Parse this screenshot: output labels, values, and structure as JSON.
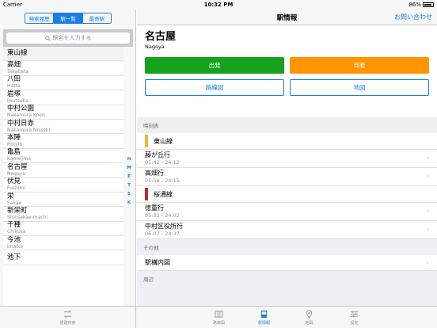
{
  "status": {
    "carrier": "Carrier",
    "time": "10:32 PM",
    "battery": "86%"
  },
  "left": {
    "segments": [
      "検索履歴",
      "駅一覧",
      "最寄駅"
    ],
    "search_placeholder": "駅名を入力する",
    "list_header": "東山線",
    "stations": [
      {
        "ja": "高畑",
        "en": "Takabata"
      },
      {
        "ja": "八田",
        "en": "Hatta"
      },
      {
        "ja": "岩塚",
        "en": "Iwatsuka"
      },
      {
        "ja": "中村公園",
        "en": "Nakamura Koen"
      },
      {
        "ja": "中村日赤",
        "en": "Nakamura Nisseki"
      },
      {
        "ja": "本陣",
        "en": "Honjin"
      },
      {
        "ja": "亀島",
        "en": "Kamejima"
      },
      {
        "ja": "名古屋",
        "en": "Nagoya"
      },
      {
        "ja": "伏見",
        "en": "Fushimi"
      },
      {
        "ja": "栄",
        "en": "Sakae"
      },
      {
        "ja": "新栄町",
        "en": "Shinsakae-machi"
      },
      {
        "ja": "千種",
        "en": "Chikusa"
      },
      {
        "ja": "今池",
        "en": "Imaike"
      },
      {
        "ja": "池下",
        "en": ""
      }
    ],
    "index": [
      "H",
      "M",
      "E",
      "T",
      "S",
      "K"
    ]
  },
  "right": {
    "nav_title": "駅情報",
    "contact_label": "お問い合わせ",
    "station_name": "名古屋",
    "station_romaji": "Nagoya",
    "depart_label": "出発",
    "arrive_label": "到着",
    "route_map_label": "路線図",
    "map_label": "地図",
    "timetable_header": "時刻表",
    "lines": [
      {
        "name": "東山線",
        "color": "#f0b432",
        "destinations": [
          {
            "dest": "藤が丘行",
            "time": "05:42 - 24:12"
          },
          {
            "dest": "高畑行",
            "time": "05:58 - 24:15"
          }
        ]
      },
      {
        "name": "桜通線",
        "color": "#c9252e",
        "destinations": [
          {
            "dest": "徳重行",
            "time": "05:32 - 24:02"
          },
          {
            "dest": "中村区役所行",
            "time": "06:07 - 24:37"
          }
        ]
      }
    ],
    "other_header": "その他",
    "station_map_label": "駅構内図",
    "nearby_header": "周辺"
  },
  "tabs": {
    "left": {
      "label": "経路検索",
      "icon": "route-search-icon"
    },
    "right": [
      {
        "label": "路線図",
        "icon": "map-book-icon"
      },
      {
        "label": "駅情報",
        "icon": "station-info-icon",
        "active": true
      },
      {
        "label": "地図",
        "icon": "location-pin-icon"
      },
      {
        "label": "設定",
        "icon": "settings-sliders-icon"
      }
    ]
  }
}
